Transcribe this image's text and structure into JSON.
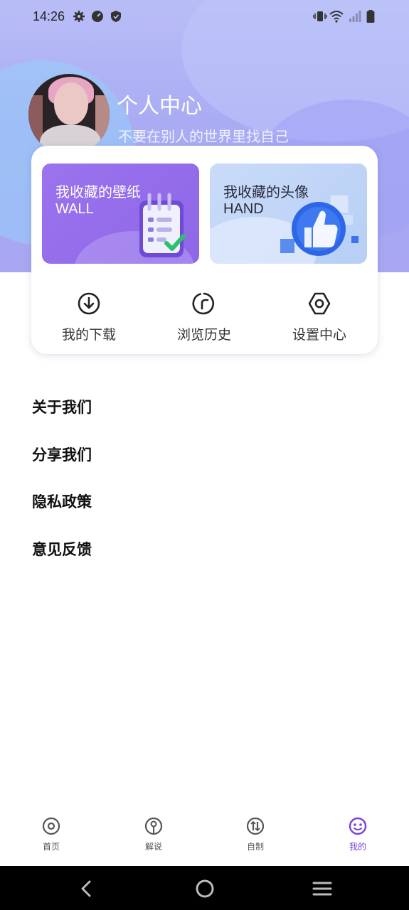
{
  "status_bar": {
    "time": "14:26",
    "icons": [
      "gear-icon",
      "clock-icon",
      "shield-icon",
      "vibrate-icon",
      "wifi-icon",
      "signal-icon",
      "battery-icon"
    ]
  },
  "profile": {
    "title": "个人中心",
    "subtitle": "不要在别人的世界里找自己"
  },
  "collections": [
    {
      "title": "我收藏的壁纸",
      "subtitle": "WALL",
      "icon": "notepad-icon"
    },
    {
      "title": "我收藏的头像",
      "subtitle": "HAND",
      "icon": "thumbs-up-icon"
    }
  ],
  "quick_actions": [
    {
      "label": "我的下载",
      "icon": "download-icon"
    },
    {
      "label": "浏览历史",
      "icon": "history-icon"
    },
    {
      "label": "设置中心",
      "icon": "settings-icon"
    }
  ],
  "menu": [
    {
      "label": "关于我们"
    },
    {
      "label": "分享我们"
    },
    {
      "label": "隐私政策"
    },
    {
      "label": "意见反馈"
    }
  ],
  "tabbar": {
    "items": [
      {
        "label": "首页",
        "icon": "home-disc-icon"
      },
      {
        "label": "解说",
        "icon": "location-icon"
      },
      {
        "label": "自制",
        "icon": "create-icon"
      },
      {
        "label": "我的",
        "icon": "smiley-icon"
      }
    ],
    "active": "我的"
  },
  "system_nav": [
    "back-icon",
    "home-icon",
    "recents-icon"
  ],
  "colors": {
    "accent": "#7b40d8",
    "hero": "#a9acf3",
    "wall_tile": "#9b73ee",
    "hand_tile": "#c9dbf8"
  }
}
